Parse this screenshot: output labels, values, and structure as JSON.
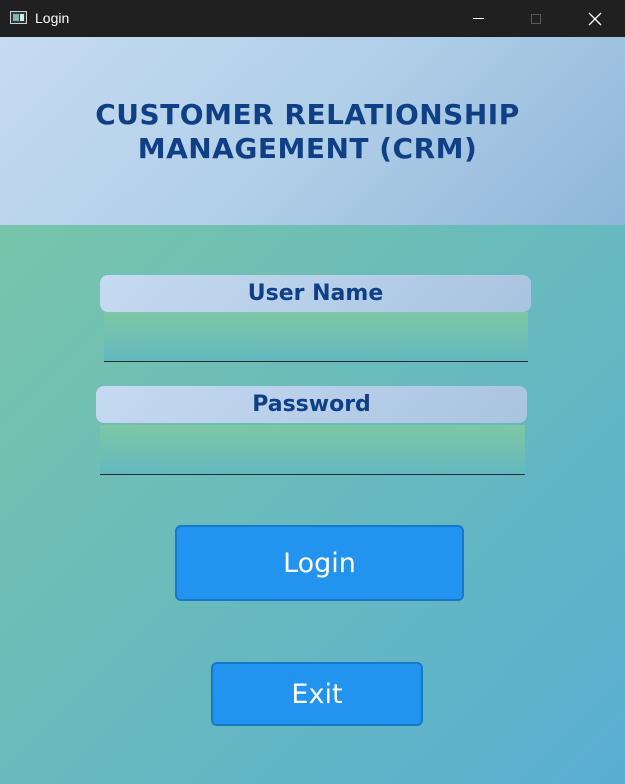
{
  "window": {
    "title": "Login",
    "icon": "app-window-icon",
    "controls": [
      "minimize-icon",
      "maximize-icon",
      "close-icon"
    ]
  },
  "header": {
    "title_line1": "CUSTOMER RELATIONSHIP",
    "title_line2": "MANAGEMENT (CRM)"
  },
  "form": {
    "username_label": "User Name",
    "username_value": "",
    "password_label": "Password",
    "password_value": ""
  },
  "buttons": {
    "login_label": "Login",
    "exit_label": "Exit"
  },
  "colors": {
    "title_text": "#0f3f84",
    "button_bg": "#2294ef",
    "button_border": "#1679c7",
    "background_start": "#7dc8a4",
    "background_end": "#5aaed2"
  }
}
